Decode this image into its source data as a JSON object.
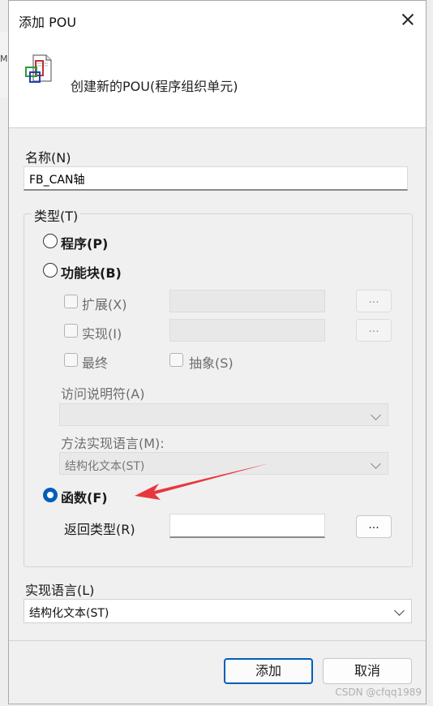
{
  "background": {
    "stub_letter": "M"
  },
  "dialog": {
    "title": "添加 POU",
    "header_text": "创建新的POU(程序组织单元)",
    "name_label": "名称(N)",
    "name_value": "FB_CAN轴",
    "type_group_label": "类型(T)",
    "type_options": {
      "program": "程序(P)",
      "function_block": "功能块(B)",
      "function": "函数(F)",
      "selected": "function"
    },
    "fb_options": {
      "extends_label": "扩展(X)",
      "implements_label": "实现(I)",
      "final_label": "最终",
      "abstract_label": "抽象(S)",
      "access_specifier_label": "访问说明符(A)",
      "access_specifier_value": "",
      "method_lang_label": "方法实现语言(M):",
      "method_lang_value": "结构化文本(ST)",
      "browse_label": "..."
    },
    "return_type_label": "返回类型(R)",
    "return_type_value": "",
    "return_browse_label": "...",
    "impl_lang_label": "实现语言(L)",
    "impl_lang_value": "结构化文本(ST)",
    "buttons": {
      "add": "添加",
      "cancel": "取消"
    }
  },
  "watermark": "CSDN @cfqq1989",
  "colors": {
    "accent": "#005fb8",
    "annotation_arrow": "#e8363d"
  }
}
